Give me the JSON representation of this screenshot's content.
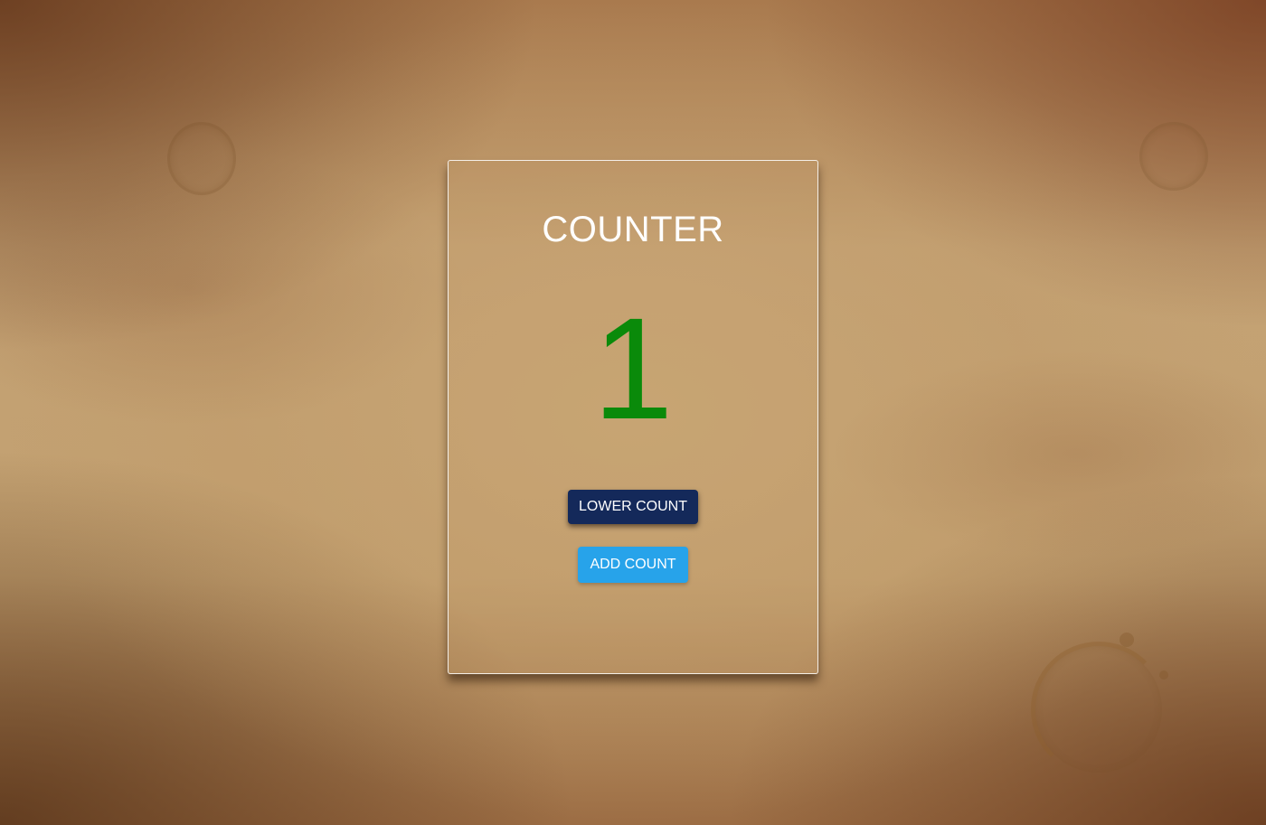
{
  "counter": {
    "title": "COUNTER",
    "value": "1",
    "value_color": "#0a8a0a",
    "lower_button_label": "LOWER COUNT",
    "add_button_label": "ADD COUNT"
  },
  "colors": {
    "lower_button": "#14295a",
    "add_button": "#27a3ea",
    "title_text": "#ffffff"
  }
}
